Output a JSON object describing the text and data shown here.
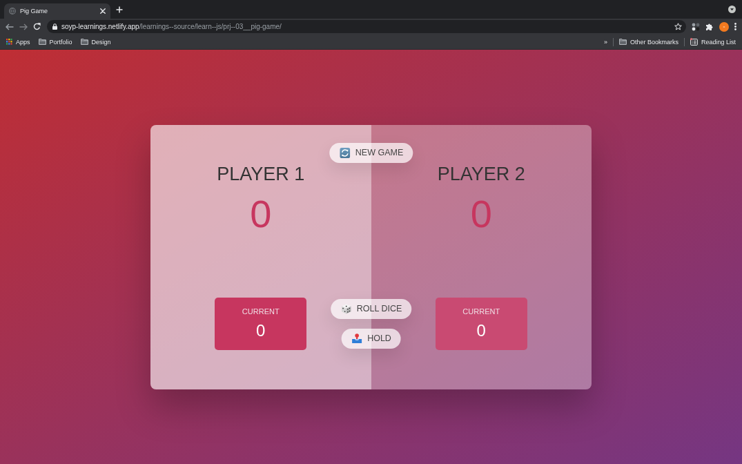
{
  "browser": {
    "tabs": [
      {
        "title": "Pig Game",
        "selected": true
      }
    ],
    "address": {
      "host": "soyp-learnings.netlify.app",
      "path": "/learnings--source/learn--js/prj--03__pig-game/"
    },
    "bookmarks": [
      {
        "kind": "apps",
        "label": "Apps"
      },
      {
        "kind": "folder",
        "label": "Portfolio"
      },
      {
        "kind": "folder",
        "label": "Design"
      }
    ],
    "overflow": "»",
    "bookmarks_right": [
      {
        "kind": "folder",
        "label": "Other Bookmarks"
      },
      {
        "kind": "reading-list",
        "label": "Reading List"
      }
    ]
  },
  "game": {
    "players": [
      {
        "name": "PLAYER 1",
        "score": "0",
        "current_label": "CURRENT",
        "current": "0",
        "selected": true
      },
      {
        "name": "PLAYER 2",
        "score": "0",
        "current_label": "CURRENT",
        "current": "0",
        "selected": false
      }
    ],
    "buttons": [
      {
        "kind": "new",
        "label": "NEW GAME"
      },
      {
        "kind": "roll",
        "label": "ROLL DICE"
      },
      {
        "kind": "hold",
        "label": "HOLD"
      }
    ]
  }
}
